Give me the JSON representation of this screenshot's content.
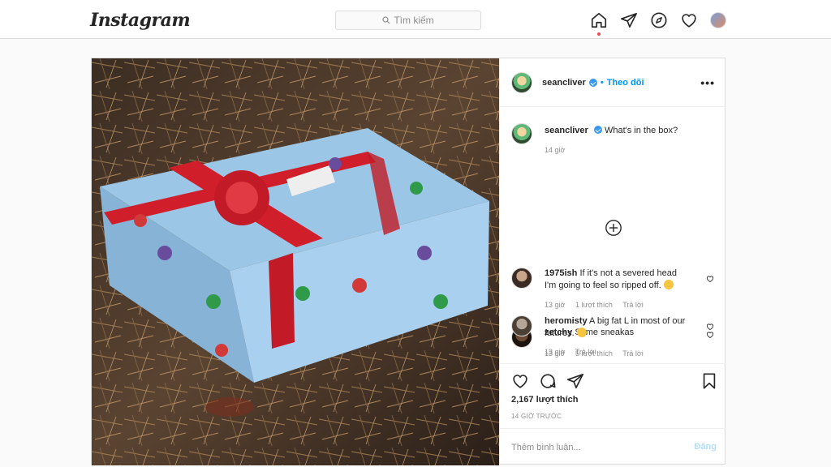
{
  "header": {
    "logo": "Instagram",
    "search_placeholder": "Tìm kiếm",
    "icons": [
      "home-icon",
      "direct-icon",
      "explore-icon",
      "activity-heart-icon",
      "profile-avatar"
    ],
    "notification_dot_color": "#ed4956"
  },
  "post": {
    "username": "seancliver",
    "verified": true,
    "separator": "•",
    "follow_label": "Theo dõi",
    "more_label": "•••",
    "caption": {
      "username": "seancliver",
      "text": "What's in the box?",
      "age": "14 giờ"
    },
    "comments": [
      {
        "username": "1975ish",
        "text": "If it's not a severed head I'm going to feel so ripped off.",
        "age": "13 giờ",
        "likes": "1 lượt thích",
        "reply": "Trả lời"
      },
      {
        "username": "zetchy",
        "text": "Some sneakas",
        "age": "13 giờ",
        "reply": "Trả lời"
      },
      {
        "username": "heromisty",
        "text": "A big fat L in most of our futures.",
        "age": "13 giờ",
        "likes": "5 lượt thích",
        "reply": "Trả lời"
      }
    ],
    "like_count": "2,167 lượt thích",
    "timestamp": "14 GIỜ TRƯỚC",
    "comment_placeholder": "Thêm bình luận...",
    "post_button": "Đăng"
  },
  "colors": {
    "accent": "#0095f6",
    "verified_badge": "#3897f0",
    "disabled_post": "#b2dffc"
  }
}
